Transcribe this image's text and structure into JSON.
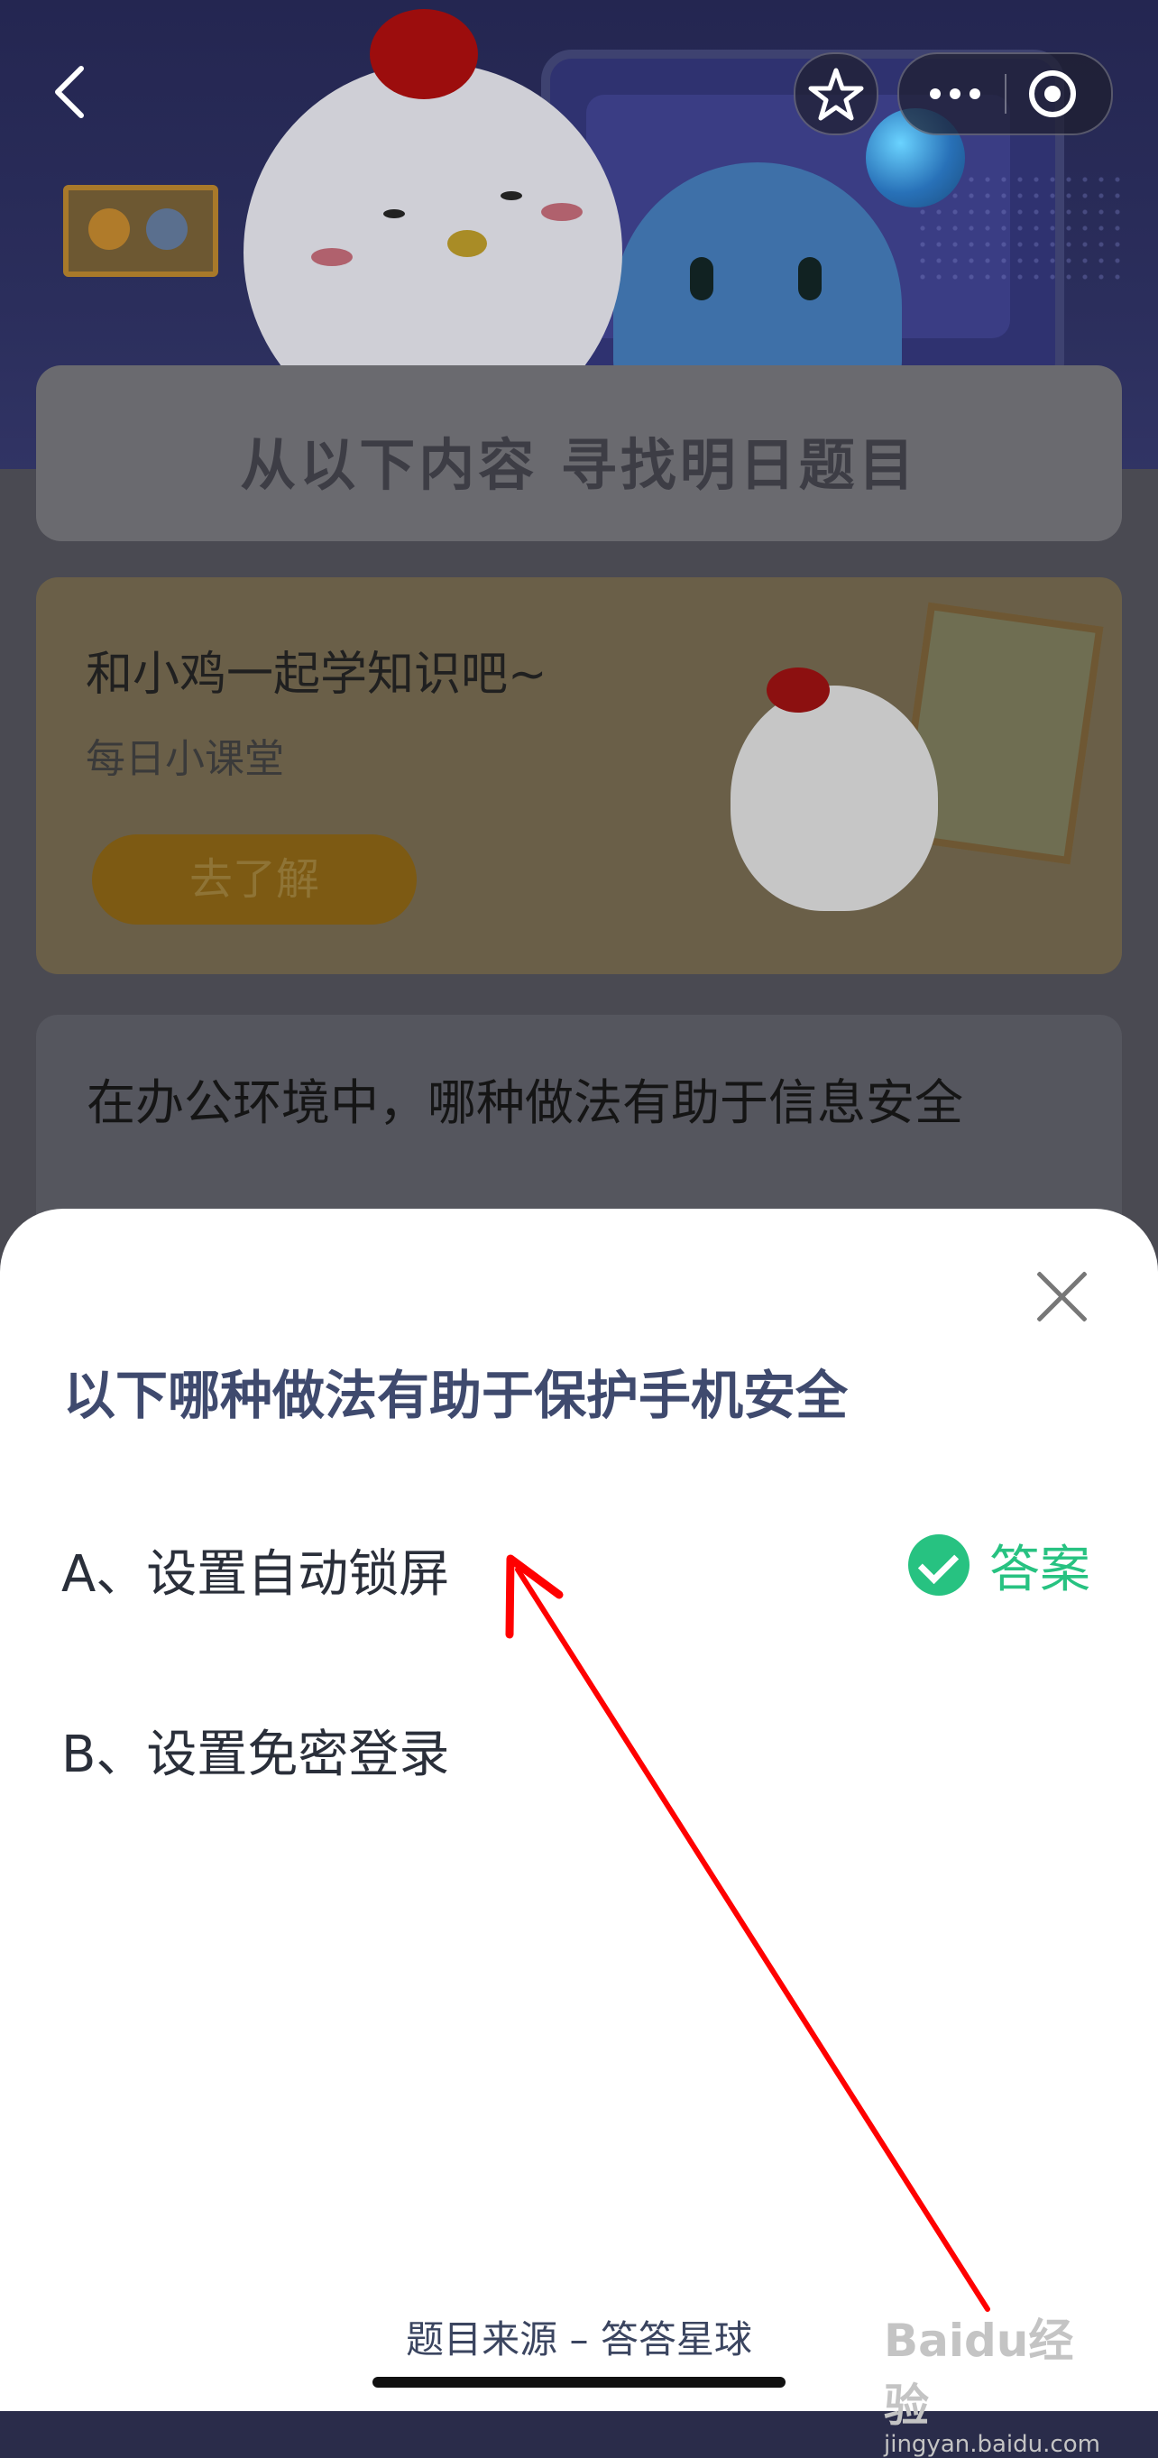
{
  "header": {
    "star_icon": "star-icon",
    "more_icon": "more-icon",
    "target_icon": "target-icon"
  },
  "page": {
    "banner_title": "从以下内容 寻找明日题目",
    "promo_card": {
      "title": "和小鸡一起学知识吧~",
      "subtitle": "每日小课堂",
      "button_label": "去了解"
    },
    "question_card": {
      "title": "在办公环境中，哪种做法有助于信息安全"
    }
  },
  "sheet": {
    "question": "以下哪种做法有助于保护手机安全",
    "options": [
      {
        "label": "A、设置自动锁屏"
      },
      {
        "label": "B、设置免密登录"
      }
    ],
    "answer_label": "答案",
    "answer_color": "#27c281",
    "source": "题目来源 – 答答星球"
  },
  "watermark": {
    "line1": "Baidu经验",
    "line2": "jingyan.baidu.com"
  },
  "annotation": {
    "arrow_color": "#ff0000"
  }
}
